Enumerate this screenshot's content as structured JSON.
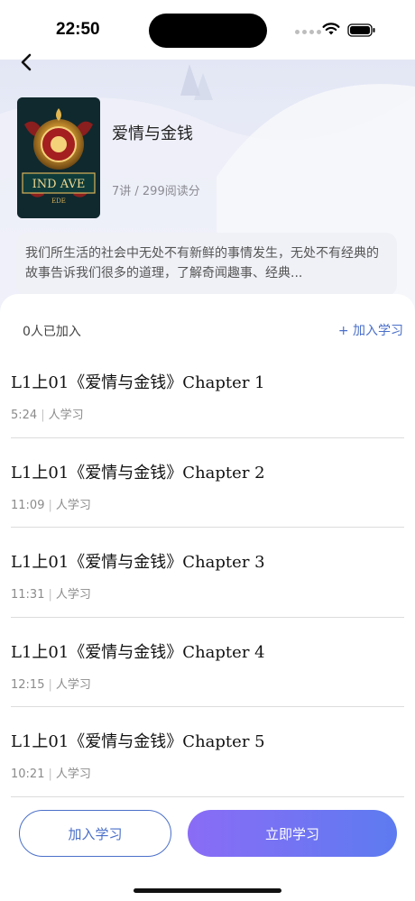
{
  "status_bar": {
    "time": "22:50"
  },
  "book": {
    "cover_text": "IND AVE",
    "cover_subtext": "EDE",
    "title": "爱情与金钱",
    "stats": "7讲 / 299阅读分",
    "description": "我们所生活的社会中无处不有新鲜的事情发生，无处不有经典的故事告诉我们很多的道理，了解奇闻趣事、经典..."
  },
  "sheet": {
    "joined_count": "0人已加入",
    "join_link": "+ 加入学习"
  },
  "chapters": [
    {
      "title": "L1上01《爱情与金钱》Chapter 1",
      "duration": "5:24",
      "sep": "|",
      "learners": "人学习"
    },
    {
      "title": "L1上01《爱情与金钱》Chapter 2",
      "duration": "11:09",
      "sep": "|",
      "learners": "人学习"
    },
    {
      "title": "L1上01《爱情与金钱》Chapter 3",
      "duration": "11:31",
      "sep": "|",
      "learners": "人学习"
    },
    {
      "title": "L1上01《爱情与金钱》Chapter 4",
      "duration": "12:15",
      "sep": "|",
      "learners": "人学习"
    },
    {
      "title": "L1上01《爱情与金钱》Chapter 5",
      "duration": "10:21",
      "sep": "|",
      "learners": "人学习"
    }
  ],
  "bottom_bar": {
    "join_button": "加入学习",
    "start_button": "立即学习"
  },
  "colors": {
    "accent": "#4a6fc9",
    "gradient_start": "#8a6cf6",
    "gradient_end": "#5d7bf0"
  }
}
